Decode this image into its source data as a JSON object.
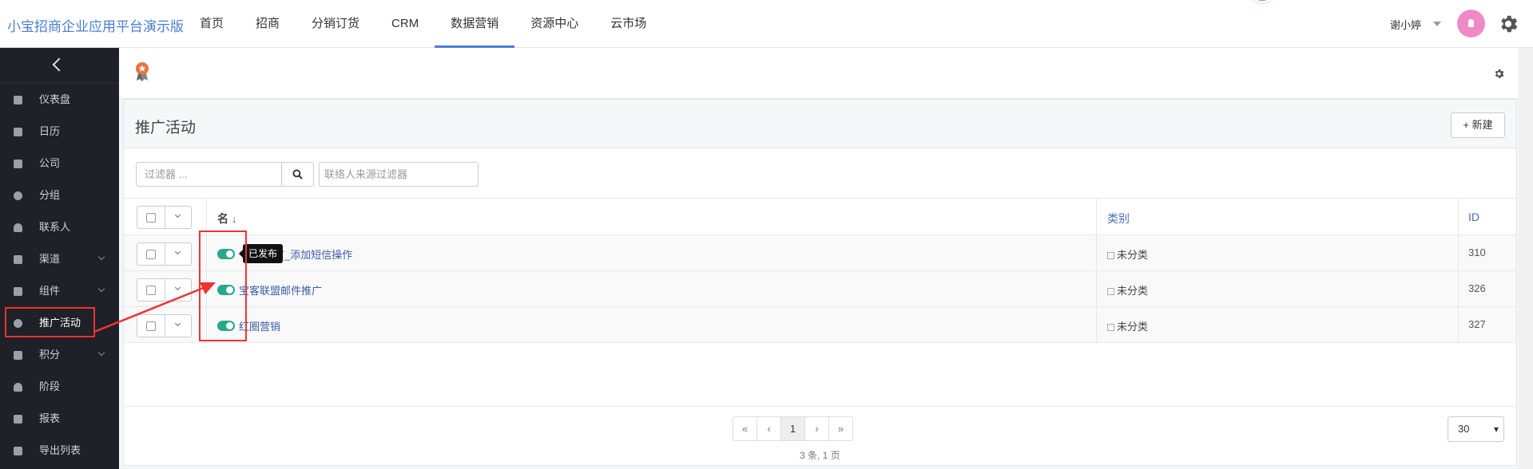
{
  "topbar": {
    "brand": "小宝招商企业应用平台演示版",
    "nav": [
      {
        "label": "首页",
        "active": false
      },
      {
        "label": "招商",
        "active": false
      },
      {
        "label": "分销订货",
        "active": false
      },
      {
        "label": "CRM",
        "active": false
      },
      {
        "label": "数据营销",
        "active": true
      },
      {
        "label": "资源中心",
        "active": false
      },
      {
        "label": "云市场",
        "active": false
      }
    ],
    "user_name": "谢小婷",
    "accent_color": "#4a7ed3",
    "avatar_color": "#f08ac6"
  },
  "sidebar": {
    "items": [
      {
        "label": "仪表盘",
        "icon": "dashboard-icon",
        "has_submenu": false
      },
      {
        "label": "日历",
        "icon": "calendar-icon",
        "has_submenu": false
      },
      {
        "label": "公司",
        "icon": "building-icon",
        "has_submenu": false
      },
      {
        "label": "分组",
        "icon": "pie-icon",
        "has_submenu": false
      },
      {
        "label": "联系人",
        "icon": "user-icon",
        "has_submenu": false
      },
      {
        "label": "渠道",
        "icon": "rss-icon",
        "has_submenu": true
      },
      {
        "label": "组件",
        "icon": "puzzle-icon",
        "has_submenu": true
      },
      {
        "label": "推广活动",
        "icon": "clock-icon",
        "has_submenu": false
      },
      {
        "label": "积分",
        "icon": "calculator-icon",
        "has_submenu": true
      },
      {
        "label": "阶段",
        "icon": "gauge-icon",
        "has_submenu": false
      },
      {
        "label": "报表",
        "icon": "line-chart-icon",
        "has_submenu": false
      },
      {
        "label": "导出列表",
        "icon": "download-icon",
        "has_submenu": false
      }
    ]
  },
  "page": {
    "title": "推广活动",
    "new_button": "+ 新建",
    "filter_placeholder": "过滤器 ...",
    "source_filter_placeholder": "联络人来源过滤器",
    "columns": {
      "name": "名",
      "sort": "↓",
      "category": "类别",
      "id": "ID"
    },
    "rows": [
      {
        "name": "推广_添加短信操作",
        "name_visible": "广_添加短信操作",
        "category": "未分类",
        "id": "310",
        "published": true
      },
      {
        "name": "宝客联盟邮件推广",
        "category": "未分类",
        "id": "326",
        "published": true
      },
      {
        "name": "红圈营销",
        "category": "未分类",
        "id": "327",
        "published": true
      }
    ],
    "tooltip": "已发布",
    "pagination": {
      "first": "«",
      "prev": "‹",
      "current": "1",
      "next": "›",
      "last": "»",
      "summary": "3 条, 1 页",
      "page_size": "30"
    },
    "toggle_color": "#26a98b"
  }
}
